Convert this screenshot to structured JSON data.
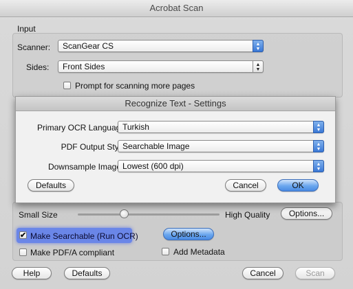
{
  "window": {
    "title": "Acrobat Scan"
  },
  "input_section": {
    "heading": "Input",
    "scanner_label": "Scanner:",
    "scanner_value": "ScanGear CS",
    "sides_label": "Sides:",
    "sides_value": "Front Sides",
    "prompt_label": "Prompt for scanning more pages",
    "prompt_checked": false
  },
  "sheet": {
    "title": "Recognize Text - Settings",
    "primary_ocr_label": "Primary OCR Language",
    "primary_ocr_value": "Turkish",
    "pdf_style_label": "PDF Output Style",
    "pdf_style_value": "Searchable Image",
    "downsample_label": "Downsample Images",
    "downsample_value": "Lowest (600 dpi)",
    "defaults_label": "Defaults",
    "cancel_label": "Cancel",
    "ok_label": "OK"
  },
  "document_settings": {
    "small_size_label": "Small Size",
    "high_quality_label": "High Quality",
    "quality_level": 0.33,
    "options_label": "Options...",
    "make_searchable_label": "Make Searchable (Run OCR)",
    "make_searchable_checked": true,
    "ocr_options_label": "Options...",
    "pdfa_label": "Make PDF/A compliant",
    "pdfa_checked": false,
    "metadata_label": "Add Metadata",
    "metadata_checked": false
  },
  "footer": {
    "help_label": "Help",
    "defaults_label": "Defaults",
    "cancel_label": "Cancel",
    "scan_label": "Scan"
  },
  "icons": {
    "stepper": "up-down-arrows",
    "checkmark": "✔"
  },
  "colors": {
    "accent": "#4a8be3",
    "highlight": "#6a86e8"
  }
}
